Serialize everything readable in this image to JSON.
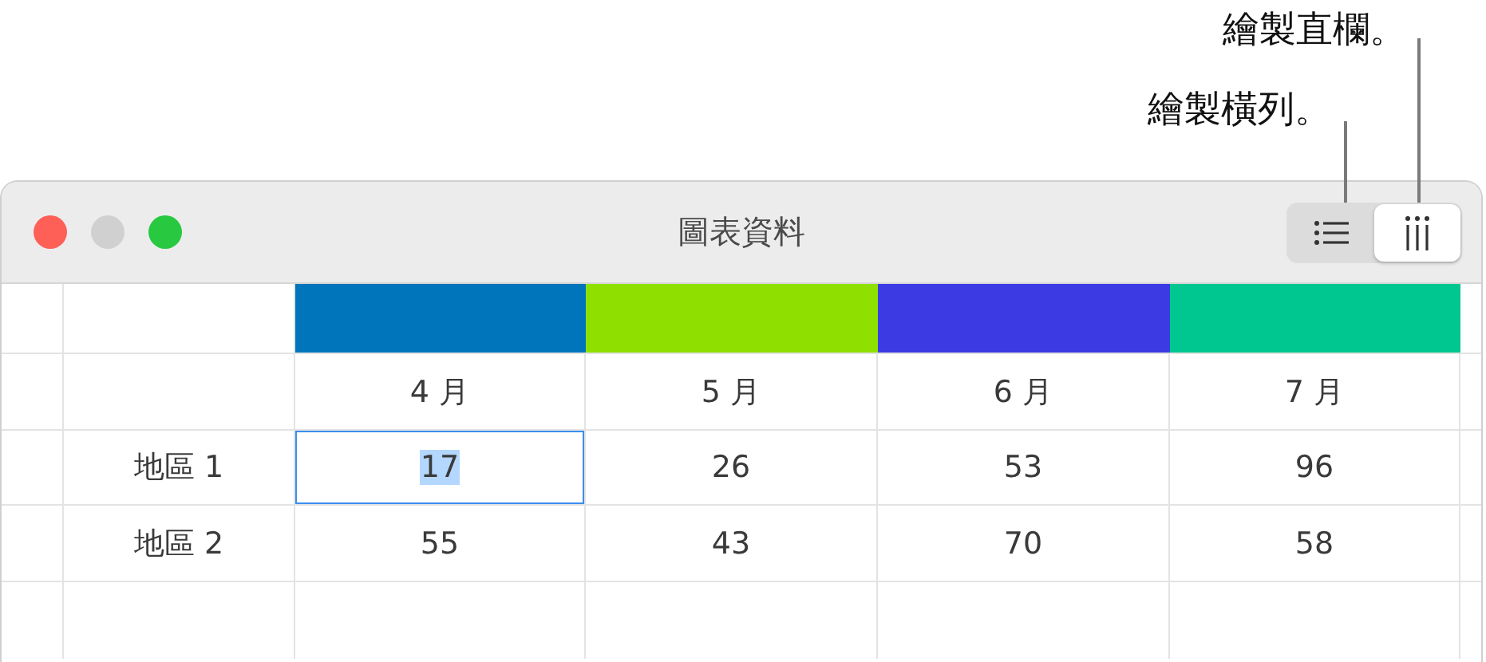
{
  "callouts": [
    {
      "text": "繪製直欄。"
    },
    {
      "text": "繪製橫列。"
    }
  ],
  "window": {
    "title": "圖表資料"
  },
  "toggle": [
    {
      "kind": "rows",
      "selected": false
    },
    {
      "kind": "columns",
      "selected": true
    }
  ],
  "table": {
    "series": [
      {
        "color": "#0075bb"
      },
      {
        "color": "#8fe000"
      },
      {
        "color": "#3b3ae3"
      },
      {
        "color": "#00c78f"
      }
    ],
    "columns": [
      "4 月",
      "5 月",
      "6 月",
      "7 月"
    ],
    "rows": [
      {
        "label": "地區 1",
        "cells": [
          {
            "value": "17",
            "selected": true
          },
          {
            "value": "26",
            "selected": false
          },
          {
            "value": "53",
            "selected": false
          },
          {
            "value": "96",
            "selected": false
          }
        ]
      },
      {
        "label": "地區 2",
        "cells": [
          {
            "value": "55",
            "selected": false
          },
          {
            "value": "43",
            "selected": false
          },
          {
            "value": "70",
            "selected": false
          },
          {
            "value": "58",
            "selected": false
          }
        ]
      }
    ]
  }
}
